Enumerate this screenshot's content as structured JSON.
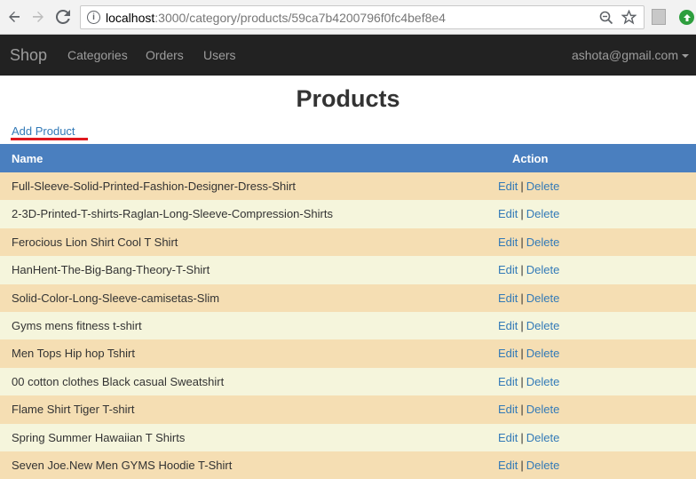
{
  "browser": {
    "url_host": "localhost",
    "url_rest": ":3000/category/products/59ca7b4200796f0fc4bef8e4"
  },
  "navbar": {
    "brand": "Shop",
    "links": [
      "Categories",
      "Orders",
      "Users"
    ],
    "user": "ashota@gmail.com"
  },
  "page": {
    "title": "Products",
    "add_link": "Add Product"
  },
  "table": {
    "headers": {
      "name": "Name",
      "action": "Action"
    },
    "edit_label": "Edit",
    "delete_label": "Delete",
    "separator": "|",
    "rows": [
      "Full-Sleeve-Solid-Printed-Fashion-Designer-Dress-Shirt",
      "2-3D-Printed-T-shirts-Raglan-Long-Sleeve-Compression-Shirts",
      "Ferocious Lion Shirt Cool T Shirt",
      "HanHent-The-Big-Bang-Theory-T-Shirt",
      "Solid-Color-Long-Sleeve-camisetas-Slim",
      "Gyms mens fitness t-shirt",
      "Men Tops Hip hop Tshirt",
      "00 cotton clothes Black casual Sweatshirt",
      "Flame Shirt Tiger T-shirt",
      "Spring Summer Hawaiian T Shirts",
      "Seven Joe.New Men GYMS Hoodie T-Shirt"
    ]
  },
  "colors": {
    "navbar_bg": "#222222",
    "table_header_bg": "#4a7fbf",
    "row_odd_bg": "#f5deb3",
    "row_even_bg": "#f5f5dc",
    "link": "#337ab7",
    "highlight_underline": "#e0191f"
  },
  "icons": [
    "back-icon",
    "forward-icon",
    "reload-icon",
    "info-icon",
    "zoom-icon",
    "star-icon",
    "extension-icon",
    "update-icon",
    "caret-down-icon"
  ]
}
